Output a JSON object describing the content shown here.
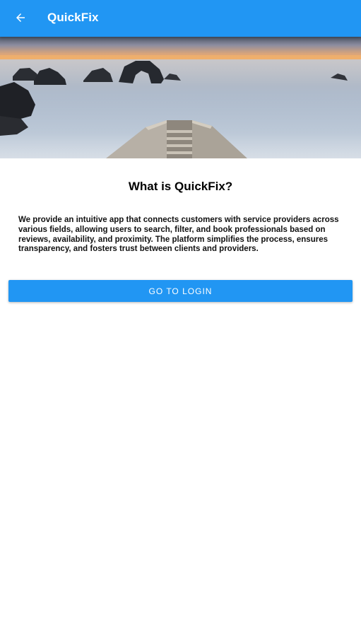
{
  "appbar": {
    "title": "QuickFix",
    "back_icon": "arrow-left-icon",
    "background_color": "#2196f3"
  },
  "hero": {
    "description_icon": "coastal-sunset-image"
  },
  "main": {
    "heading": "What is QuickFix?",
    "description": "We provide an intuitive app that connects customers with service providers across various fields, allowing users to search, filter, and book professionals based on reviews, availability, and proximity. The platform simplifies the process, ensures transparency, and fosters trust between clients and providers.",
    "login_button_label": "GO TO LOGIN",
    "accent_color": "#2196f3"
  }
}
